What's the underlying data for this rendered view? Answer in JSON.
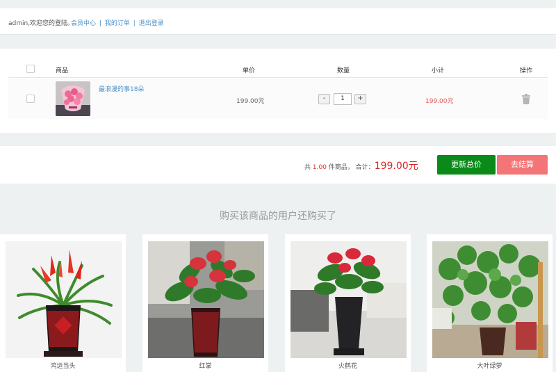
{
  "topbar": {
    "welcome": "admin,欢迎您的登陆。",
    "member_center": "会员中心",
    "my_orders": "我的订单",
    "logout": "退出登录",
    "separator": "|"
  },
  "cart": {
    "headers": {
      "product": "商品",
      "unit_price": "单价",
      "quantity": "数量",
      "subtotal": "小计",
      "action": "操作"
    },
    "items": [
      {
        "name": "最浪漫的事18朵",
        "price": "199.00元",
        "quantity": "1",
        "subtotal": "199.00元"
      }
    ],
    "minus": "-",
    "plus": "+"
  },
  "summary": {
    "prefix": "共",
    "count": "1.00",
    "middle": "件商品， 合计：",
    "total": "199.00元",
    "update_label": "更新总价",
    "checkout_label": "去结算"
  },
  "recommend": {
    "title": "购买该商品的用户还购买了",
    "items": [
      {
        "name": "鸿运当头"
      },
      {
        "name": "红掌"
      },
      {
        "name": "火鹤花"
      },
      {
        "name": "大叶绿萝"
      }
    ]
  },
  "colors": {
    "link": "#4a90c8",
    "update": "#0a8a18",
    "checkout": "#f37577",
    "price_red": "#e05a57"
  }
}
